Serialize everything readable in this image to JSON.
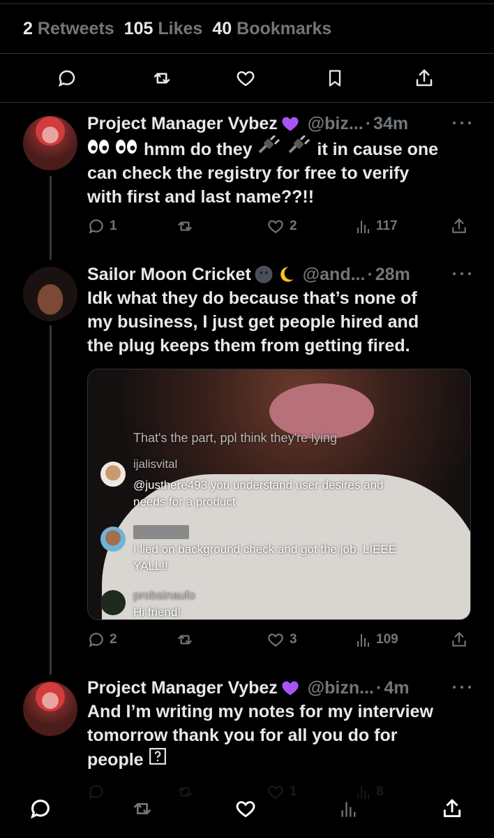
{
  "stats": {
    "retweets_count": "2",
    "retweets_label": "Retweets",
    "likes_count": "105",
    "likes_label": "Likes",
    "bookmarks_count": "40",
    "bookmarks_label": "Bookmarks"
  },
  "action_icons": [
    "reply-icon",
    "retweet-icon",
    "like-icon",
    "bookmark-icon",
    "share-icon"
  ],
  "tweets": [
    {
      "name": "Project Manager Vybez",
      "handle": "@biz...",
      "dot": "·",
      "time": "34m",
      "text_parts": [
        "hmm do they",
        "it in cause one",
        "can check the registry for free to verify",
        "with first and last name??!!"
      ],
      "replies": "1",
      "retweets": "",
      "likes": "2",
      "views": "117"
    },
    {
      "name": "Sailor Moon Cricket",
      "handle": "@and...",
      "dot": "·",
      "time": "28m",
      "text_lines": [
        "Idk what they do because that’s none of",
        "my business, I just get people hired and",
        "the plug keeps them from getting fired."
      ],
      "replies": "2",
      "retweets": "",
      "likes": "3",
      "views": "109",
      "media": {
        "caption_top": "That's the part, ppl think they're lying",
        "comment1_user": "ijalisvital",
        "comment1_text_1": "@justhere493 you understand user desires and",
        "comment1_text_2": "needs for a product",
        "comment2_text_1": "I lied on background check and got the job. LIEEE",
        "comment2_text_2": "YALL!!",
        "comment3_user": "probsinaufo",
        "comment3_text": "Hi friend!"
      }
    },
    {
      "name": "Project Manager Vybez",
      "handle": "@bizn...",
      "dot": "·",
      "time": "4m",
      "text_lines": [
        "And I’m writing my notes for my interview",
        "tomorrow thank you for all you do for",
        "people"
      ],
      "likes": "1",
      "views": "8"
    }
  ],
  "colors": {
    "background": "#000000",
    "text": "#e7e9ea",
    "muted": "#71767b",
    "divider": "#2f3336",
    "purple_heart": "#a855f7"
  }
}
